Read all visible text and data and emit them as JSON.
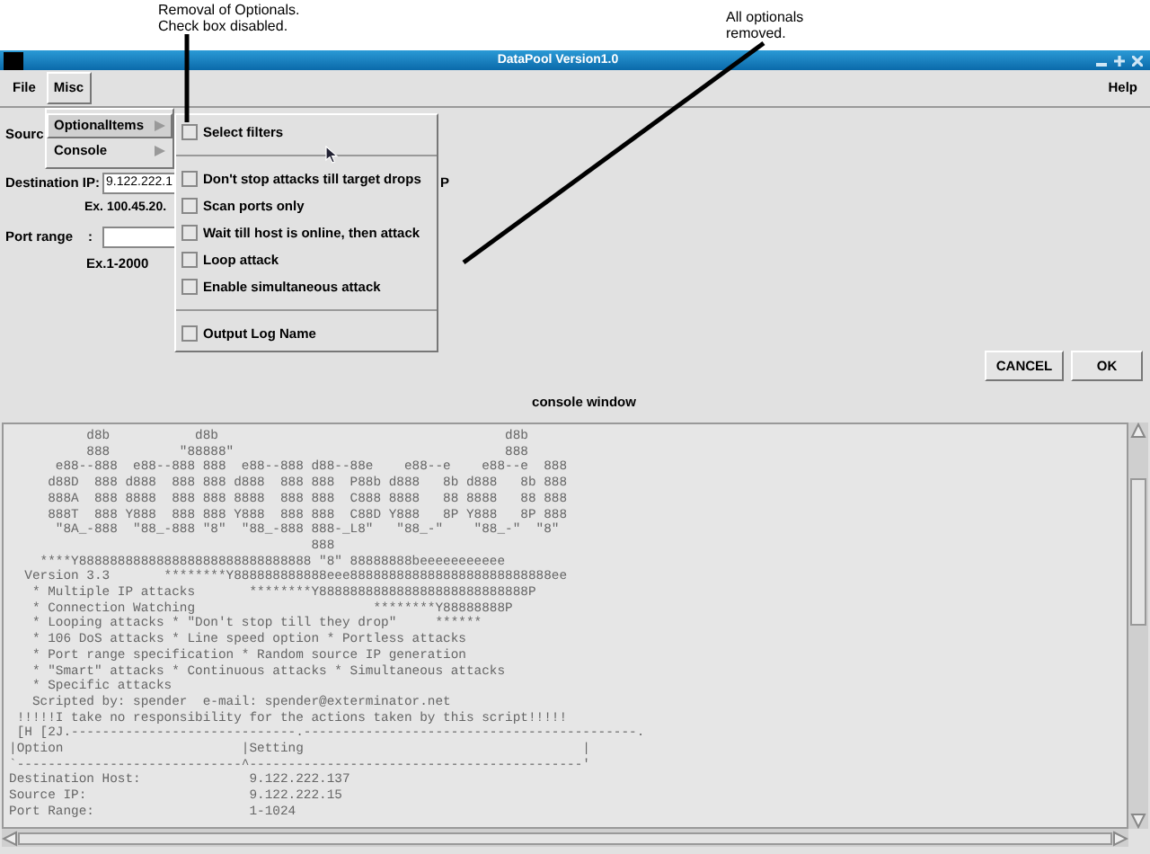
{
  "annotations": [
    {
      "lines": [
        "Removal of Optionals.",
        "Check box disabled."
      ]
    },
    {
      "lines": [
        "All optionals",
        "removed."
      ]
    }
  ],
  "window": {
    "title": "DataPool Version1.0"
  },
  "menu_bar": [
    {
      "label": "File",
      "selected": false
    },
    {
      "label": "Misc",
      "selected": true
    },
    {
      "label": "Help",
      "selected": false
    }
  ],
  "misc_menu": [
    {
      "label": "OptionalItems",
      "selected": true
    },
    {
      "label": "Console",
      "selected": false
    }
  ],
  "submenu": [
    {
      "kind": "check",
      "label": "Select filters",
      "checked": false
    },
    {
      "kind": "separator"
    },
    {
      "kind": "check",
      "label": "Don't stop attacks till target drops",
      "checked": false
    },
    {
      "kind": "check",
      "label": "Scan ports only",
      "checked": false
    },
    {
      "kind": "check",
      "label": "Wait till host is online, then attack",
      "checked": false
    },
    {
      "kind": "check",
      "label": "Loop attack",
      "checked": false
    },
    {
      "kind": "check",
      "label": "Enable simultaneous attack",
      "checked": false
    },
    {
      "kind": "separator"
    },
    {
      "kind": "check",
      "label": "Output Log Name",
      "checked": false
    }
  ],
  "form": {
    "source_label": "Sourc",
    "destination_label": "Destination IP:",
    "destination_value": "9.122.222.1",
    "destination_trailing": "P",
    "destination_hint": "Ex. 100.45.20.",
    "port_label": "Port range",
    "port_colon": ":",
    "port_hint": "Ex.1-2000"
  },
  "buttons": [
    "CANCEL",
    "OK"
  ],
  "console": {
    "title": "console window",
    "lines": [
      "          d8b           d8b                                     d8b",
      "          888         \"88888\"                                   888",
      "      e88--888  e88--888 888  e88--888 d88--88e    e88--e    e88--e  888",
      "     d88D  888 d888  888 888 d888  888 888  P88b d888   8b d888   8b 888",
      "     888A  888 8888  888 888 8888  888 888  C888 8888   88 8888   88 888",
      "     888T  888 Y888  888 888 Y888  888 888  C88D Y888   8P Y888   8P 888",
      "      \"8A_-888  \"88_-888 \"8\"  \"88_-888 888-_L8\"   \"88_-\"    \"88_-\"  \"8\"",
      "                                       888",
      "    ****Y888888888888888888888888888888 \"8\" 88888888beeeeeeeeeee",
      "  Version 3.3       ********Y888888888888eee88888888888888888888888888ee",
      "   * Multiple IP attacks       ********Y888888888888888888888888888P",
      "   * Connection Watching                       ********Y88888888P",
      "   * Looping attacks * \"Don't stop till they drop\"     ******",
      "   * 106 DoS attacks * Line speed option * Portless attacks",
      "   * Port range specification * Random source IP generation",
      "   * \"Smart\" attacks * Continuous attacks * Simultaneous attacks",
      "   * Specific attacks",
      "   Scripted by: spender  e-mail: spender@exterminator.net",
      " !!!!!I take no responsibility for the actions taken by this script!!!!!",
      " [H [2J.-----------------------------.-------------------------------------------.",
      "|Option                       |Setting                                    |",
      "`-----------------------------^-------------------------------------------'",
      "Destination Host:              9.122.222.137",
      "Source IP:                     9.122.222.15",
      "Port Range:                    1-1024"
    ]
  }
}
